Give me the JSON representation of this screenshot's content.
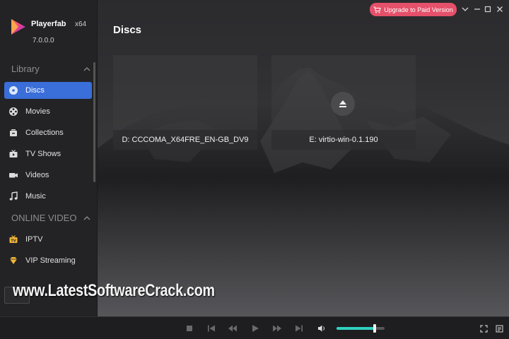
{
  "app": {
    "name": "Playerfab",
    "arch": "x64",
    "version": "7.0.0.0"
  },
  "titlebar": {
    "upgrade_label": "Upgrade to Paid Version",
    "accent": "#e5506a"
  },
  "sidebar": {
    "library_title": "Library",
    "library_items": [
      {
        "label": "Discs",
        "icon": "disc-icon",
        "active": true
      },
      {
        "label": "Movies",
        "icon": "film-reel-icon"
      },
      {
        "label": "Collections",
        "icon": "collections-icon"
      },
      {
        "label": "TV Shows",
        "icon": "tv-icon"
      },
      {
        "label": "Videos",
        "icon": "video-camera-icon"
      },
      {
        "label": "Music",
        "icon": "music-note-icon"
      }
    ],
    "online_title": "ONLINE VIDEO",
    "online_items": [
      {
        "label": "IPTV",
        "icon": "iptv-icon"
      },
      {
        "label": "VIP Streaming",
        "icon": "vip-diamond-icon"
      }
    ],
    "active_color": "#3a6ed8"
  },
  "main": {
    "title": "Discs",
    "discs": [
      {
        "label": "D: CCCOMA_X64FRE_EN-GB_DV9"
      },
      {
        "label": "E: virtio-win-0.1.190",
        "eject_icon": "eject-icon"
      }
    ]
  },
  "watermark": "www.LatestSoftwareCrack.com",
  "player": {
    "volume_fraction": 0.8,
    "volume_color": "#2fd1c0"
  }
}
